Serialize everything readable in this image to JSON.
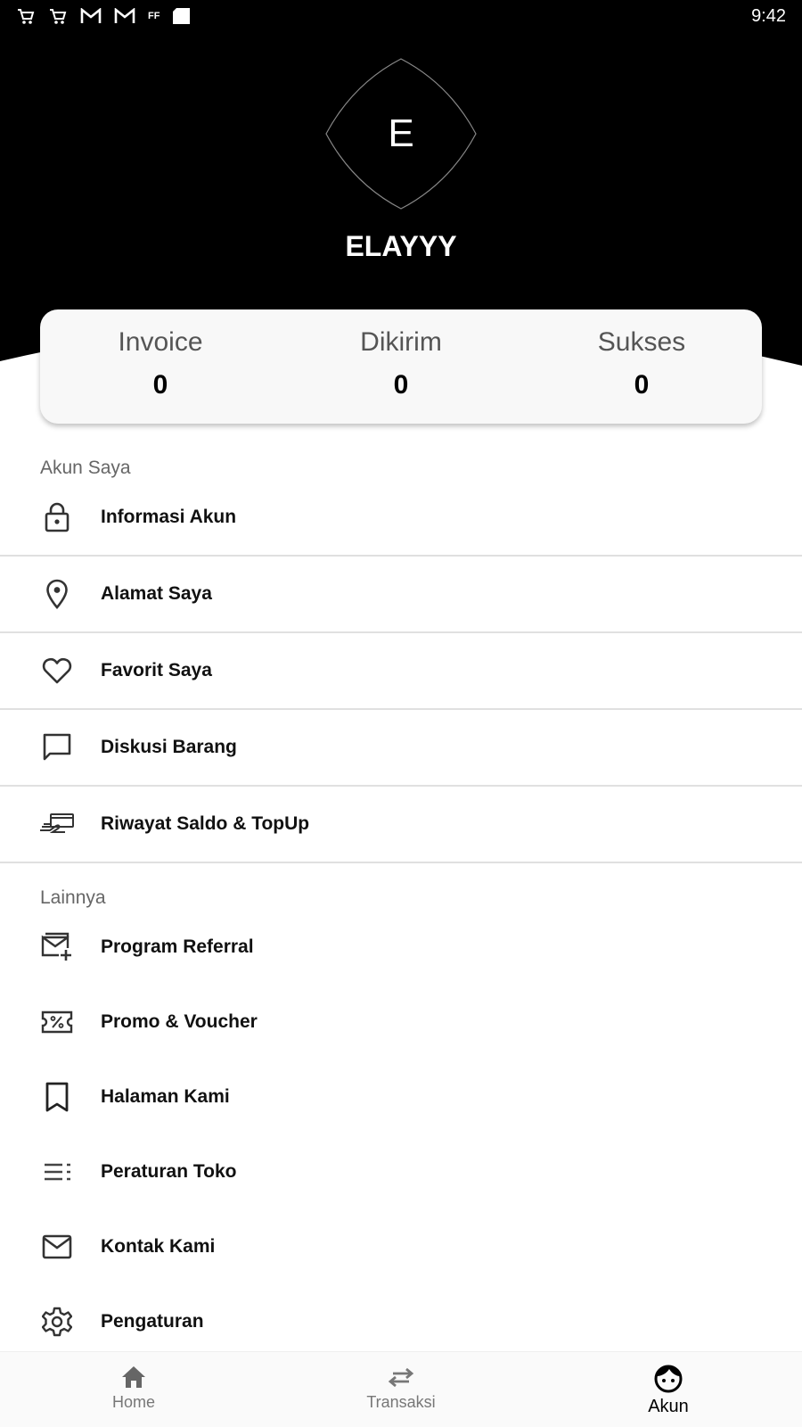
{
  "status_bar": {
    "time": "9:42",
    "notification_icons": [
      "cart-icon",
      "cart-icon",
      "gmail-icon",
      "gmail-icon",
      "ff-icon",
      "sd-card-icon"
    ],
    "ff_text": "FF"
  },
  "profile": {
    "initial": "E",
    "name": "ELAYYY"
  },
  "stats": [
    {
      "label": "Invoice",
      "value": "0"
    },
    {
      "label": "Dikirim",
      "value": "0"
    },
    {
      "label": "Sukses",
      "value": "0"
    }
  ],
  "sections": {
    "akun_saya": "Akun Saya",
    "lainnya": "Lainnya"
  },
  "akun_items": [
    {
      "label": "Informasi Akun",
      "icon": "lock-icon"
    },
    {
      "label": "Alamat Saya",
      "icon": "location-pin-icon"
    },
    {
      "label": "Favorit Saya",
      "icon": "heart-icon"
    },
    {
      "label": "Diskusi Barang",
      "icon": "chat-bubble-icon"
    },
    {
      "label": "Riwayat Saldo & TopUp",
      "icon": "payment-hand-icon"
    }
  ],
  "lainnya_items": [
    {
      "label": "Program Referral",
      "icon": "referral-mail-icon"
    },
    {
      "label": "Promo & Voucher",
      "icon": "voucher-icon"
    },
    {
      "label": "Halaman Kami",
      "icon": "bookmark-icon"
    },
    {
      "label": "Peraturan Toko",
      "icon": "list-icon"
    },
    {
      "label": "Kontak Kami",
      "icon": "mail-icon"
    },
    {
      "label": "Pengaturan",
      "icon": "gear-icon"
    }
  ],
  "bottom_nav": [
    {
      "label": "Home",
      "icon": "home-icon",
      "active": false
    },
    {
      "label": "Transaksi",
      "icon": "swap-arrows-icon",
      "active": false
    },
    {
      "label": "Akun",
      "icon": "face-icon",
      "active": true
    }
  ],
  "colors": {
    "header_bg": "#000000",
    "card_bg": "#f8f8f8",
    "divider": "#e0e0e0",
    "text_primary": "#111111",
    "text_secondary": "#666666"
  }
}
